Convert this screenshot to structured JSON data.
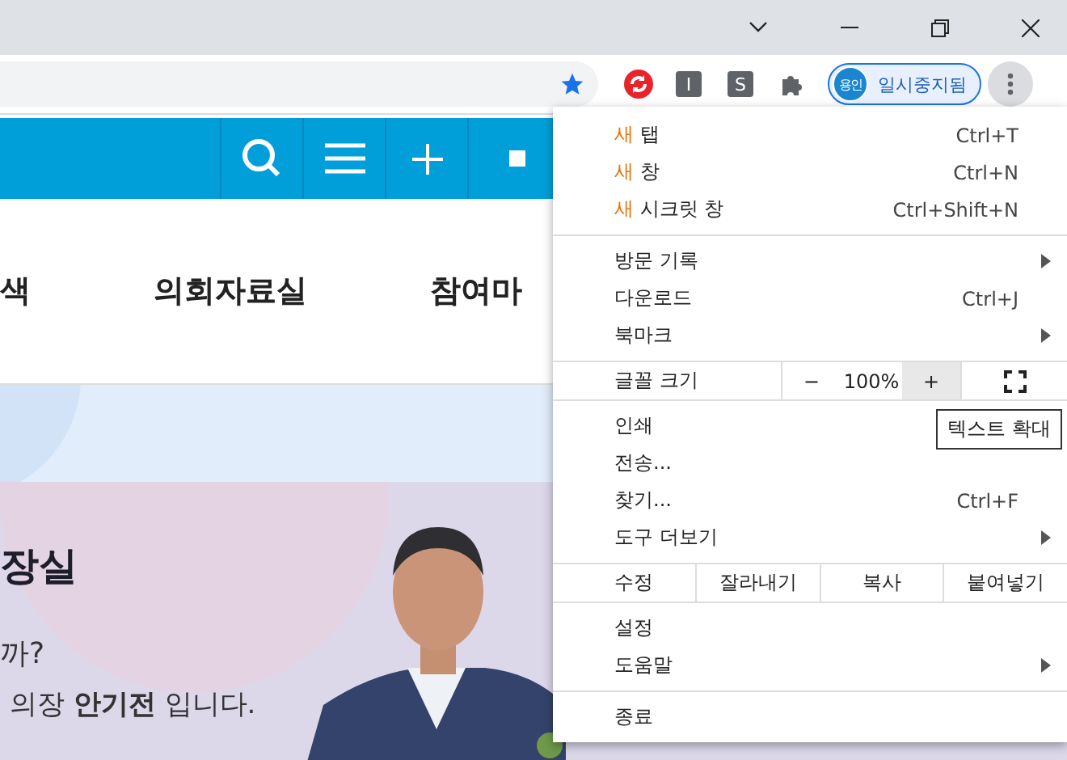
{
  "toolbar": {
    "extensions": [
      {
        "kind": "sync"
      },
      {
        "kind": "letter",
        "label": "I"
      },
      {
        "kind": "letter",
        "label": "S"
      },
      {
        "kind": "puzzle"
      }
    ],
    "profile": {
      "avatar": "용인",
      "label": "일시중지됨"
    },
    "menu_button": {
      "pressed": true
    }
  },
  "page": {
    "nav": [
      "색",
      "의회자료실",
      "참여마"
    ],
    "hero": {
      "title": "장실",
      "question": "까?",
      "greeting": "의장 **안기전** 입니다."
    }
  },
  "menu": {
    "sections": [
      [
        {
          "kind": "item",
          "prefix": "새",
          "label": "탭",
          "shortcut": "Ctrl+T",
          "submenu": false
        },
        {
          "kind": "item",
          "prefix": "새",
          "label": "창",
          "shortcut": "Ctrl+N",
          "submenu": false
        },
        {
          "kind": "item",
          "prefix": "새",
          "label": "시크릿 창",
          "shortcut": "Ctrl+Shift+N",
          "submenu": false
        }
      ],
      [
        {
          "kind": "item",
          "label": "방문 기록",
          "submenu": true
        },
        {
          "kind": "item",
          "label": "다운로드",
          "shortcut": "Ctrl+J",
          "submenu": false
        },
        {
          "kind": "item",
          "label": "북마크",
          "submenu": true
        }
      ],
      [
        {
          "kind": "zoom",
          "label": "글꼴 크기",
          "value": "100%",
          "buttons": [
            {
              "text": "−",
              "hovered": false
            },
            {
              "text": "+",
              "hovered": true
            }
          ]
        }
      ],
      [
        {
          "kind": "item",
          "label": "인쇄",
          "submenu": false
        },
        {
          "kind": "item",
          "label": "전송...",
          "submenu": false
        },
        {
          "kind": "item",
          "label": "찾기...",
          "shortcut": "Ctrl+F",
          "submenu": false
        },
        {
          "kind": "item",
          "label": "도구 더보기",
          "submenu": true
        }
      ],
      [
        {
          "kind": "edit",
          "label": "수정",
          "buttons": [
            "잘라내기",
            "복사",
            "붙여넣기"
          ]
        }
      ],
      [
        {
          "kind": "item",
          "label": "설정",
          "submenu": false
        },
        {
          "kind": "item",
          "label": "도움말",
          "submenu": true
        }
      ],
      [
        {
          "kind": "item",
          "label": "종료",
          "submenu": false
        }
      ]
    ]
  },
  "tooltip": "텍스트 확대"
}
